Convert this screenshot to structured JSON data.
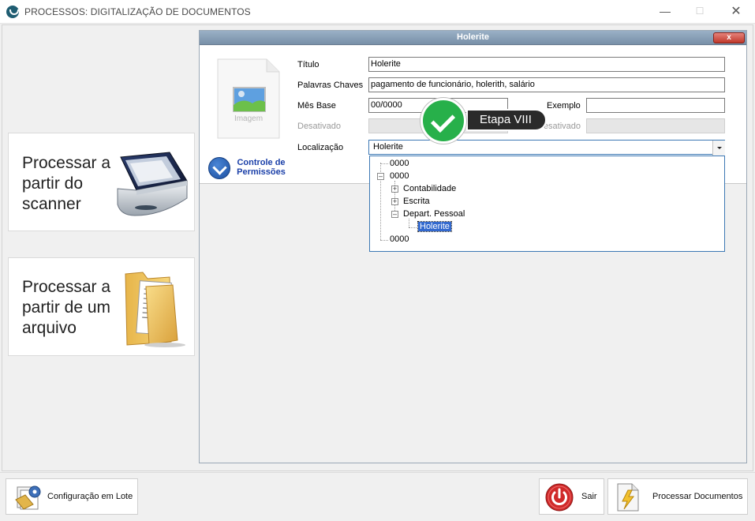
{
  "window": {
    "title": "PROCESSOS: DIGITALIZAÇÃO DE DOCUMENTOS",
    "min_glyph": "—",
    "max_glyph": "☐",
    "close_glyph": "✕"
  },
  "left_buttons": {
    "scanner": {
      "label": "Processar a partir do scanner",
      "icon": "scanner-icon"
    },
    "file": {
      "label": "Processar a partir de um arquivo",
      "icon": "folder-icon"
    }
  },
  "panel": {
    "title": "Holerite",
    "close_glyph": "x",
    "image_caption": "Imagem",
    "permissions_label": "Controle de Permissões"
  },
  "form": {
    "titulo_label": "Título",
    "titulo_value": "Holerite",
    "palavras_label": "Palavras Chaves",
    "palavras_value": "pagamento de funcionário, holerith, salário",
    "mes_label": "Mês Base",
    "mes_value": "00/0000",
    "exemplo_label": "Exemplo",
    "exemplo_value": "",
    "desativado_label": "Desativado",
    "desativado2_label": "Desativado",
    "localizacao_label": "Localização",
    "localizacao_value": "Holerite"
  },
  "tree": {
    "root1": "0000",
    "root2": "0000",
    "child1": "Contabilidade",
    "child2": "Escrita",
    "child3": "Depart. Pessoal",
    "grandchild": "Holerite",
    "root3": "0000"
  },
  "callout": {
    "label": "Etapa VIII",
    "color": "#27b04a"
  },
  "bottom": {
    "lote_label": "Configuração em Lote",
    "sair_label": "Sair",
    "processar_label": "Processar Documentos"
  }
}
